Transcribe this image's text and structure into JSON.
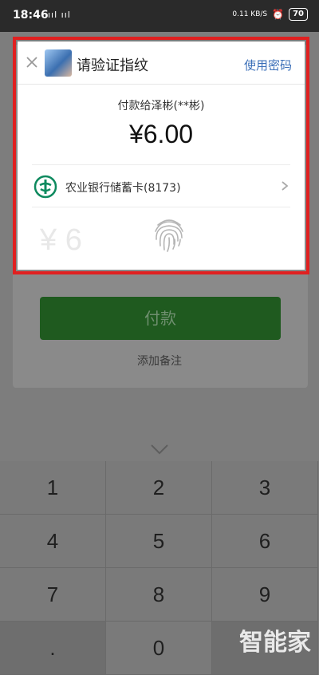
{
  "status_bar": {
    "time": "18:46",
    "signals": "ııl ııl",
    "speed": "0.11 KB/S",
    "battery": "70"
  },
  "background": {
    "pay_button": "付款",
    "add_note": "添加备注"
  },
  "dialog": {
    "title": "请验证指纹",
    "use_password": "使用密码",
    "payee": "付款给泽彬(**彬)",
    "amount": "¥6.00",
    "card": "农业银行储蓄卡(8173)",
    "ghost_amount": "¥ 6"
  },
  "keypad": {
    "keys": [
      "1",
      "2",
      "3",
      "4",
      "5",
      "6",
      "7",
      "8",
      "9",
      ".",
      "0",
      ""
    ]
  },
  "watermark": "智能家",
  "colors": {
    "highlight": "#e02020",
    "link": "#3b6fb8",
    "pay_green": "#1f5a1f",
    "bank_green": "#0f8a5f"
  }
}
